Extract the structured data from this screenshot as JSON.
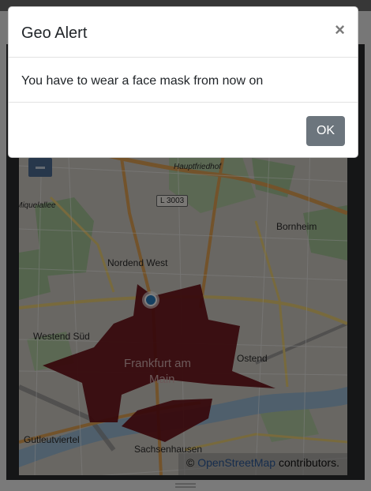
{
  "modal": {
    "title": "Geo Alert",
    "close_label": "×",
    "message": "You have to wear a face mask from now on",
    "ok_label": "OK"
  },
  "map": {
    "labels": {
      "hauptfriedhof": "Hauptfriedhof",
      "road": "L 3003",
      "miquelallee": "Miquelallee",
      "bornheim": "Bornheim",
      "nordend_west": "Nordend West",
      "westend_sud": "Westend Süd",
      "ostend": "Ostend",
      "frankfurt": "Frankfurt am",
      "main": "Main",
      "gutleutviertel": "Gutleutviertel",
      "sachsenhausen": "Sachsenhausen"
    },
    "attribution": {
      "prefix": "©",
      "link": "OpenStreetMap",
      "suffix": "contributors."
    },
    "polygon_color": "#6b0f16",
    "location_marker_color": "#2b7fc1"
  },
  "icons": {
    "close": "close-icon",
    "zoom_out": "minus-icon",
    "location": "location-dot-icon",
    "grabber": "drag-handle-icon"
  }
}
